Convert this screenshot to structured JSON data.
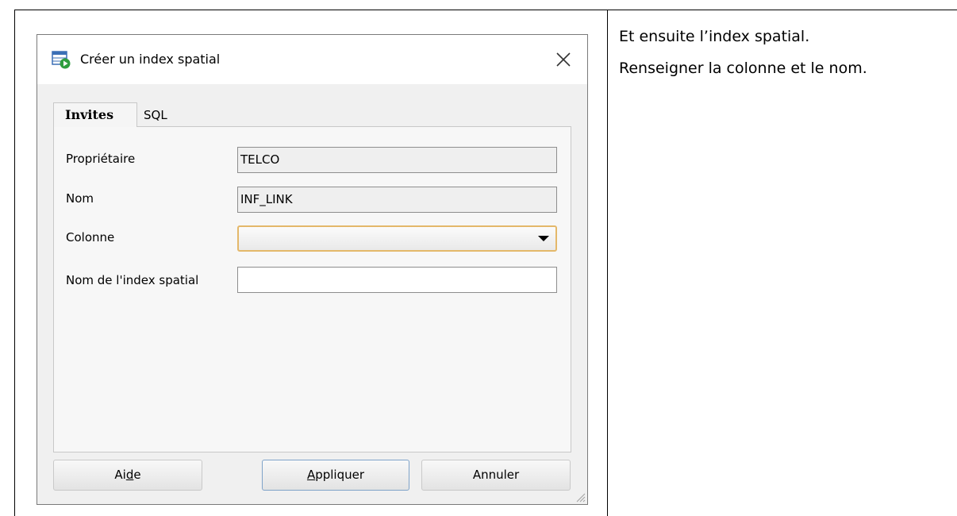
{
  "notes": {
    "line1": "Et ensuite l’index spatial.",
    "line2": "Renseigner la colonne et le nom."
  },
  "dialog": {
    "title": "Créer un index spatial",
    "app_icon": "spatial-index-icon",
    "close_icon": "close-icon",
    "tabs": [
      {
        "label": "Invites",
        "active": true
      },
      {
        "label": "SQL",
        "active": false
      }
    ],
    "fields": {
      "owner_label": "Propriétaire",
      "owner_value": "TELCO",
      "name_label": "Nom",
      "name_value": "INF_LINK",
      "column_label": "Colonne",
      "column_value": "",
      "index_name_label": "Nom de l'index spatial",
      "index_name_value": ""
    },
    "buttons": {
      "help_prefix": "Ai",
      "help_mnemonic": "d",
      "help_suffix": "e",
      "apply_mnemonic": "A",
      "apply_suffix": "ppliquer",
      "cancel": "Annuler"
    },
    "colors": {
      "combo_focus_border": "#e4b86a",
      "default_button_border": "#7fa3c9",
      "icon_green": "#2e9e3e",
      "icon_blue": "#3b6fb6"
    }
  }
}
